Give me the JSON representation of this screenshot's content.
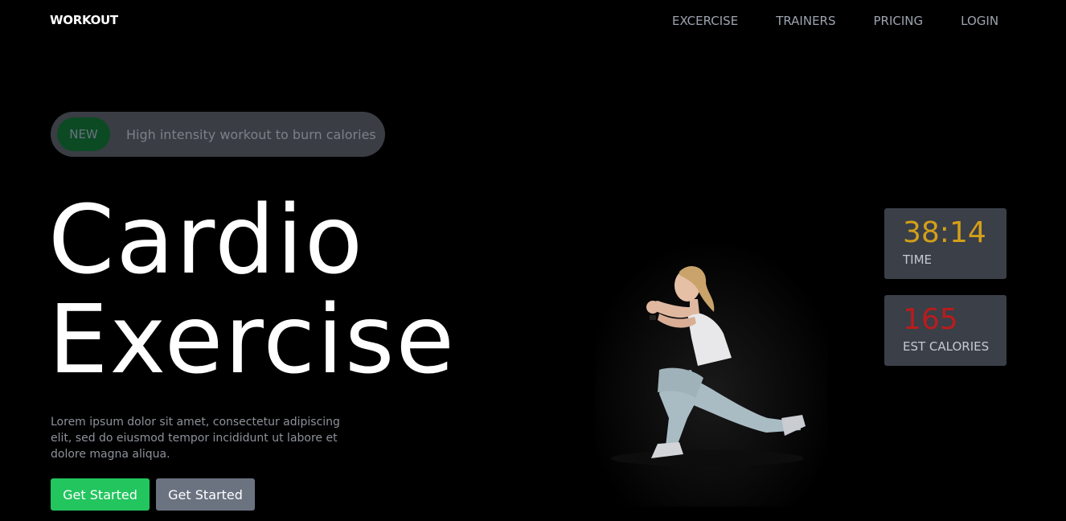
{
  "brand": {
    "logo": "WORKOUT"
  },
  "nav": {
    "items": [
      {
        "label": "EXCERCISE"
      },
      {
        "label": "TRAINERS"
      },
      {
        "label": "PRICING"
      },
      {
        "label": "LOGIN"
      }
    ]
  },
  "announcement": {
    "badge": "NEW",
    "text": "High intensity workout to burn calories"
  },
  "hero": {
    "title_line1": "Cardio",
    "title_line2": "Exercise",
    "description": "Lorem ipsum dolor sit amet, consectetur adipiscing elit, sed do eiusmod tempor incididunt ut labore et dolore magna aliqua.",
    "primary_button": "Get Started",
    "secondary_button": "Get Started"
  },
  "stats": {
    "time": {
      "value": "38:14",
      "label": "TIME"
    },
    "calories": {
      "value": "165",
      "label": "EST CALORIES"
    }
  },
  "colors": {
    "background": "#000000",
    "accent_green": "#22c55e",
    "time_yellow": "#d4a017",
    "calories_red": "#b91c1c",
    "card_gray": "#3a3f48"
  }
}
